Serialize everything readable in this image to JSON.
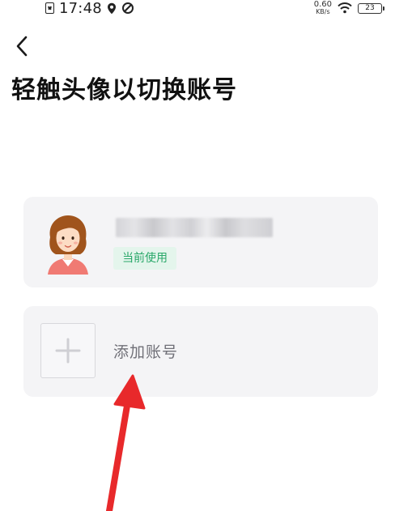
{
  "status_bar": {
    "time": "17:48",
    "net_speed_value": "0.60",
    "net_speed_unit": "KB/s",
    "battery_level": "23",
    "icons": [
      "sim-icon",
      "location-icon",
      "sync-icon",
      "wifi-icon",
      "battery-icon"
    ]
  },
  "header": {
    "back_icon": "chevron-left-icon",
    "title": "轻触头像以切换账号"
  },
  "accounts": [
    {
      "avatar": "avatar-woman",
      "name_masked": true,
      "status_badge": "当前使用"
    }
  ],
  "add_account": {
    "icon": "plus-icon",
    "label": "添加账号"
  },
  "annotation": {
    "type": "red-arrow",
    "color": "#e8292b",
    "points_to": "add_account"
  },
  "colors": {
    "badge_bg": "#e4f5ec",
    "badge_text": "#2aa86a",
    "card_bg": "#f4f4f6"
  }
}
